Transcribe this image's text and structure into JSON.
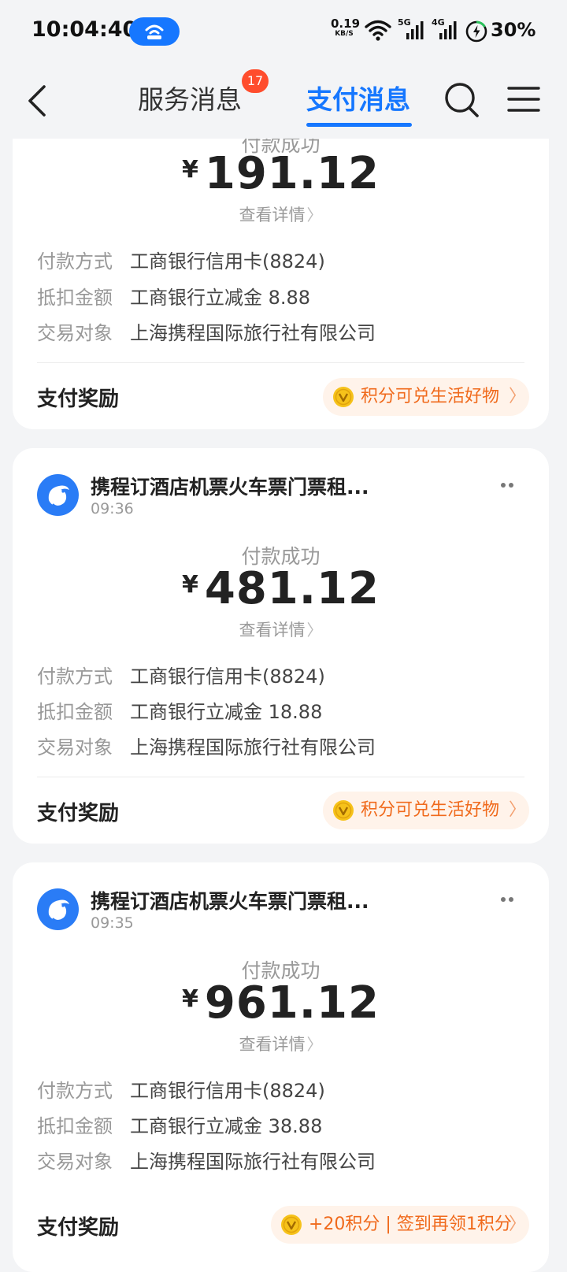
{
  "status_bar": {
    "time": "10:04:40",
    "net_speed_value": "0.19",
    "net_speed_unit": "KB/S",
    "signal_5g": "5G",
    "signal_4g": "4G",
    "battery": "30%"
  },
  "nav": {
    "tabs": [
      {
        "label": "服务消息",
        "badge": "17"
      },
      {
        "label": "支付消息"
      }
    ]
  },
  "cards": [
    {
      "sender": "",
      "time": "",
      "status": "付款成功",
      "currency": "¥",
      "amount": "191.12",
      "detail_link": "查看详情",
      "rows": [
        {
          "label": "付款方式",
          "value": "工商银行信用卡(8824)"
        },
        {
          "label": "抵扣金额",
          "value": "工商银行立减金 8.88"
        },
        {
          "label": "交易对象",
          "value": "上海携程国际旅行社有限公司"
        }
      ],
      "reward_label": "支付奖励",
      "reward_text": "积分可兑生活好物"
    },
    {
      "sender": "携程订酒店机票火车票门票租...",
      "time": "09:36",
      "status": "付款成功",
      "currency": "¥",
      "amount": "481.12",
      "detail_link": "查看详情",
      "rows": [
        {
          "label": "付款方式",
          "value": "工商银行信用卡(8824)"
        },
        {
          "label": "抵扣金额",
          "value": "工商银行立减金 18.88"
        },
        {
          "label": "交易对象",
          "value": "上海携程国际旅行社有限公司"
        }
      ],
      "reward_label": "支付奖励",
      "reward_text": "积分可兑生活好物"
    },
    {
      "sender": "携程订酒店机票火车票门票租...",
      "time": "09:35",
      "status": "付款成功",
      "currency": "¥",
      "amount": "961.12",
      "detail_link": "查看详情",
      "rows": [
        {
          "label": "付款方式",
          "value": "工商银行信用卡(8824)"
        },
        {
          "label": "抵扣金额",
          "value": "工商银行立减金 38.88"
        },
        {
          "label": "交易对象",
          "value": "上海携程国际旅行社有限公司"
        }
      ],
      "reward_label": "支付奖励",
      "reward_text": "+20积分 | 签到再领1积分"
    }
  ],
  "colors": {
    "accent": "#1677ff",
    "badge": "#ff4d2d",
    "reward_text": "#f06a1c",
    "reward_bg": "#fff3ea",
    "background": "#f3f4f6"
  },
  "icons": [
    "back-arrow-icon",
    "search-icon",
    "menu-icon",
    "ctrip-dolphin-icon",
    "more-dots-icon",
    "points-coin-icon",
    "chevron-right-icon",
    "wifi-icon",
    "signal-icon",
    "battery-icon",
    "hotspot-icon"
  ]
}
